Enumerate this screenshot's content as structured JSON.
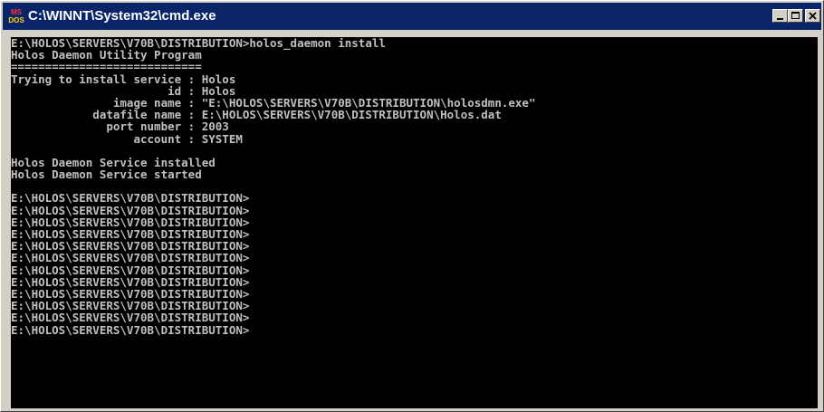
{
  "window": {
    "title": "C:\\WINNT\\System32\\cmd.exe",
    "icon_label_top": "MS",
    "icon_label_bottom": "DOS"
  },
  "console": {
    "lines": [
      "E:\\HOLOS\\SERVERS\\V70B\\DISTRIBUTION>holos_daemon install",
      "Holos Daemon Utility Program",
      "============================",
      "Trying to install service : Holos",
      "                       id : Holos",
      "               image name : \"E:\\HOLOS\\SERVERS\\V70B\\DISTRIBUTION\\holosdmn.exe\"",
      "            datafile name : E:\\HOLOS\\SERVERS\\V70B\\DISTRIBUTION\\Holos.dat",
      "              port number : 2003",
      "                  account : SYSTEM",
      "",
      "Holos Daemon Service installed",
      "Holos Daemon Service started",
      "",
      "E:\\HOLOS\\SERVERS\\V70B\\DISTRIBUTION>",
      "E:\\HOLOS\\SERVERS\\V70B\\DISTRIBUTION>",
      "E:\\HOLOS\\SERVERS\\V70B\\DISTRIBUTION>",
      "E:\\HOLOS\\SERVERS\\V70B\\DISTRIBUTION>",
      "E:\\HOLOS\\SERVERS\\V70B\\DISTRIBUTION>",
      "E:\\HOLOS\\SERVERS\\V70B\\DISTRIBUTION>",
      "E:\\HOLOS\\SERVERS\\V70B\\DISTRIBUTION>",
      "E:\\HOLOS\\SERVERS\\V70B\\DISTRIBUTION>",
      "E:\\HOLOS\\SERVERS\\V70B\\DISTRIBUTION>",
      "E:\\HOLOS\\SERVERS\\V70B\\DISTRIBUTION>",
      "E:\\HOLOS\\SERVERS\\V70B\\DISTRIBUTION>",
      "E:\\HOLOS\\SERVERS\\V70B\\DISTRIBUTION>"
    ]
  }
}
